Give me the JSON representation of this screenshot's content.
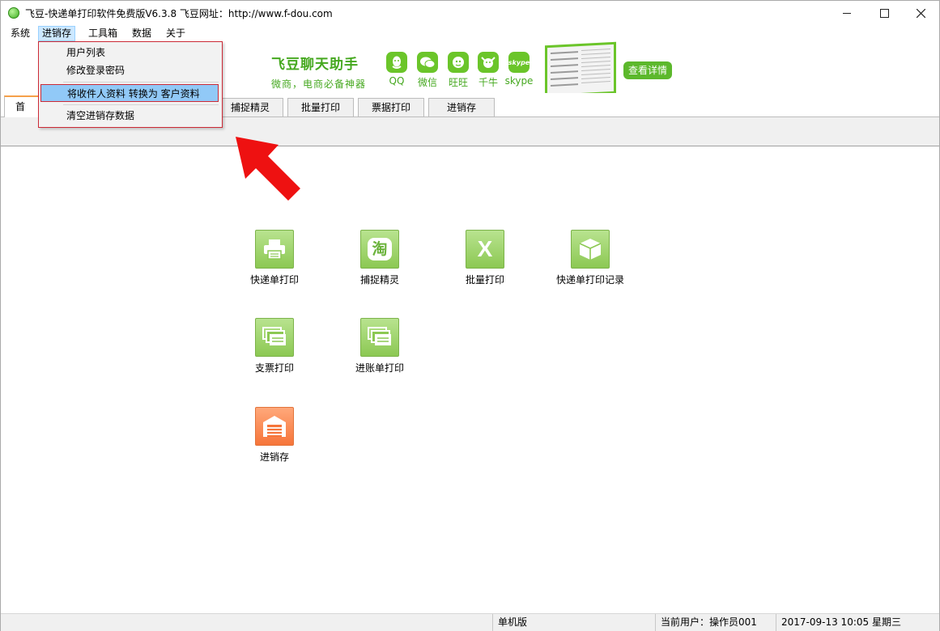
{
  "window": {
    "title": "飞豆-快递单打印软件免费版V6.3.8  飞豆网址：http://www.f-dou.com"
  },
  "menubar": {
    "items": [
      "系统",
      "进销存",
      "工具箱",
      "数据",
      "关于"
    ],
    "active": "进销存"
  },
  "dropdown": {
    "items": [
      {
        "label": "用户列表"
      },
      {
        "label": "修改登录密码"
      },
      {
        "label": "将收件人资料 转换为 客户资料",
        "highlighted": true
      },
      {
        "label": "清空进销存数据"
      }
    ]
  },
  "banner": {
    "title": "飞豆聊天助手",
    "subtitle": "微商，电商必备神器",
    "apps": [
      {
        "label": "QQ",
        "icon": "qq-icon"
      },
      {
        "label": "微信",
        "icon": "wechat-icon"
      },
      {
        "label": "旺旺",
        "icon": "wangwang-icon"
      },
      {
        "label": "千牛",
        "icon": "qianniu-icon"
      },
      {
        "label": "skype",
        "icon": "skype-icon",
        "glyph": "skype"
      }
    ],
    "details_button": "查看详情"
  },
  "tabs": [
    {
      "label": "首",
      "active": true
    },
    {
      "label": "捕捉精灵"
    },
    {
      "label": "批量打印"
    },
    {
      "label": "票据打印"
    },
    {
      "label": "进销存"
    }
  ],
  "tiles": [
    {
      "label": "快递单打印",
      "icon": "printer-icon"
    },
    {
      "label": "捕捉精灵",
      "icon": "taobao-icon",
      "glyph": "淘"
    },
    {
      "label": "批量打印",
      "icon": "excel-icon",
      "glyph": "X"
    },
    {
      "label": "快递单打印记录",
      "icon": "package-box-icon"
    },
    {
      "label": "支票打印",
      "icon": "check-stack-icon"
    },
    {
      "label": "进账单打印",
      "icon": "deposit-slip-icon"
    },
    {
      "label": "进销存",
      "icon": "warehouse-icon"
    }
  ],
  "statusbar": {
    "mode": "单机版",
    "user": "当前用户：操作员001",
    "datetime": "2017-09-13 10:05 星期三"
  },
  "colors": {
    "accent_green": "#6bc52a",
    "tile_green": "#8cc853",
    "tile_orange": "#f6753a",
    "highlight_border": "#cc2a36",
    "arrow_red": "#ee1111"
  }
}
